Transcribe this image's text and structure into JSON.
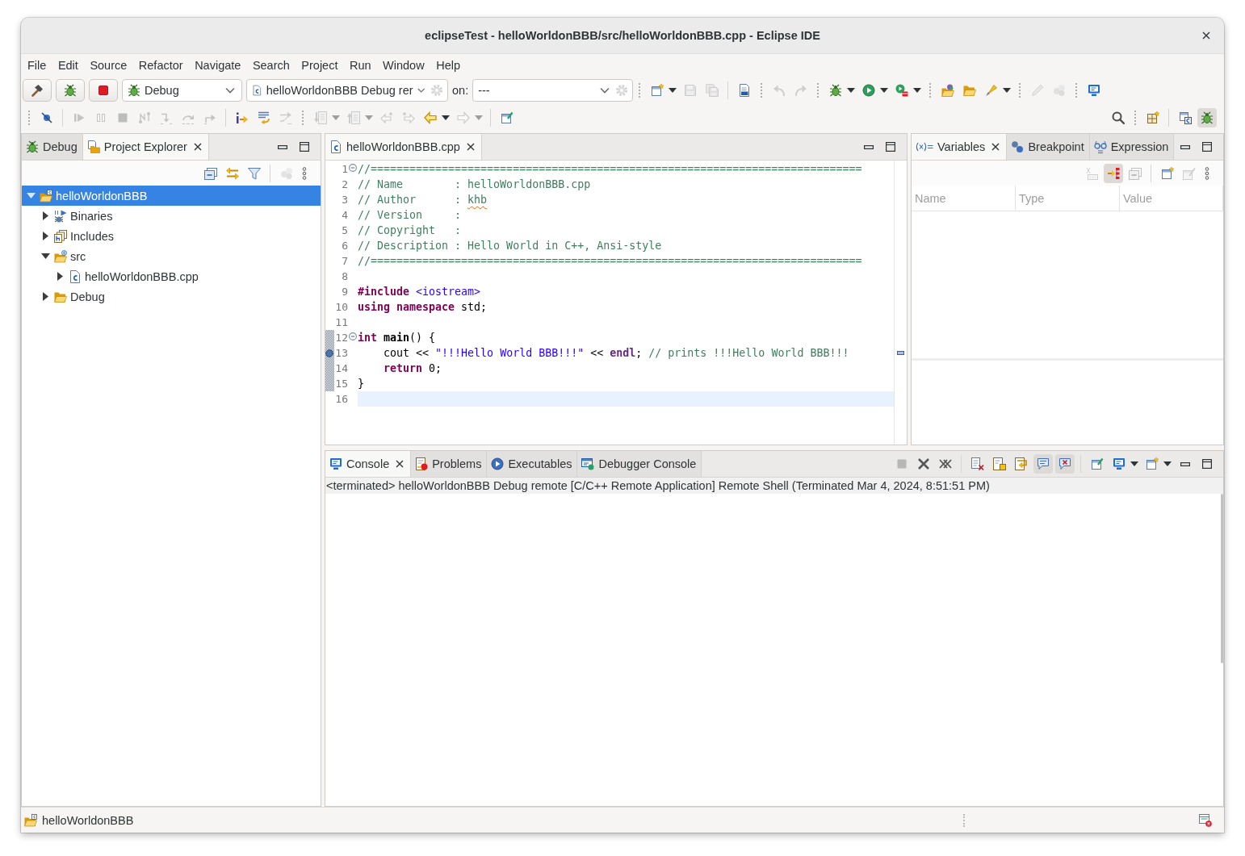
{
  "window": {
    "title": "eclipseTest - helloWorldonBBB/src/helloWorldonBBB.cpp - Eclipse IDE"
  },
  "menu": [
    "File",
    "Edit",
    "Source",
    "Refactor",
    "Navigate",
    "Search",
    "Project",
    "Run",
    "Window",
    "Help"
  ],
  "main_toolbar": {
    "launch_mode": "Debug",
    "launch_configuration": "helloWorldonBBB Debug rer",
    "target_label": "on:",
    "target": "---",
    "buttons": [
      {
        "disabled": false
      },
      {
        "disabled": false
      },
      {
        "disabled": false
      },
      {
        "disabled": true
      },
      {
        "disabled": true
      },
      {
        "disabled": false
      },
      {
        "disabled": false
      },
      {
        "disabled": true
      },
      {
        "disabled": true
      },
      {
        "disabled": false
      },
      {
        "disabled": true
      },
      {
        "disabled": true
      },
      {
        "disabled": false
      },
      {
        "disabled": false
      },
      {
        "disabled": false
      },
      {
        "disabled": false
      },
      {
        "disabled": false
      },
      {
        "disabled": false
      },
      {
        "disabled": false
      },
      {
        "disabled": false
      },
      {
        "disabled": false
      },
      {
        "disabled": false
      },
      {
        "disabled": true
      },
      {
        "disabled": true
      },
      {
        "disabled": false
      }
    ]
  },
  "debug_toolbar": {
    "buttons": [
      {
        "disabled": false,
        "on": false
      },
      {
        "disabled": true,
        "on": false
      },
      {
        "disabled": true,
        "on": false
      },
      {
        "disabled": true,
        "on": false
      },
      {
        "disabled": true,
        "on": false
      },
      {
        "disabled": true,
        "on": false
      },
      {
        "disabled": true,
        "on": false
      },
      {
        "disabled": true,
        "on": false
      },
      {
        "disabled": false,
        "on": false
      },
      {
        "disabled": false,
        "on": false
      },
      {
        "disabled": true,
        "on": false
      },
      {
        "disabled": true,
        "on": false
      },
      {
        "disabled": true,
        "on": false
      },
      {
        "disabled": true,
        "on": false
      },
      {
        "disabled": true,
        "on": false
      },
      {
        "disabled": true,
        "on": false
      },
      {
        "disabled": true,
        "on": false
      },
      {
        "disabled": false,
        "on": false
      },
      {
        "disabled": false,
        "on": false
      },
      {
        "disabled": true,
        "on": false
      },
      {
        "disabled": true,
        "on": false
      },
      {
        "disabled": false,
        "on": false
      },
      {
        "disabled": false,
        "on": false
      },
      {
        "disabled": false,
        "on": false
      },
      {
        "disabled": false,
        "on": false
      },
      {
        "disabled": false,
        "on": true
      }
    ]
  },
  "project_explorer": {
    "tabs": [
      {
        "label": "Debug",
        "selected": false
      },
      {
        "label": "Project Explorer",
        "selected": true
      }
    ],
    "toolbar": [
      {
        "disabled": false
      },
      {
        "disabled": false
      },
      {
        "disabled": false
      },
      {
        "disabled": true
      },
      {
        "disabled": false
      }
    ],
    "tree": [
      {
        "label": "helloWorldonBBB",
        "kind": "project",
        "expanded": true,
        "selected": true,
        "children": [
          {
            "label": "Binaries",
            "kind": "binaries",
            "expanded": false,
            "selected": false
          },
          {
            "label": "Includes",
            "kind": "includes",
            "expanded": false,
            "selected": false
          },
          {
            "label": "src",
            "kind": "source_folder",
            "expanded": true,
            "selected": false,
            "children": [
              {
                "label": "helloWorldonBBB.cpp",
                "kind": "source_file",
                "expanded": false,
                "selected": false
              }
            ]
          },
          {
            "label": "Debug",
            "kind": "folder",
            "expanded": false,
            "selected": false
          }
        ]
      }
    ]
  },
  "editor": {
    "tabs": [
      {
        "label": "helloWorldonBBB.cpp",
        "selected": true
      }
    ],
    "lines": [
      {
        "number": "1",
        "fold_marker": true,
        "breakpoint": false,
        "range_indicator": false,
        "current": false,
        "tokens": [
          {
            "text": "//============================================================================",
            "kind": "comment"
          }
        ]
      },
      {
        "number": "2",
        "fold_marker": false,
        "breakpoint": false,
        "range_indicator": false,
        "current": false,
        "tokens": [
          {
            "text": "// Name        : helloWorldonBBB.cpp",
            "kind": "comment"
          }
        ]
      },
      {
        "number": "3",
        "fold_marker": false,
        "breakpoint": false,
        "range_indicator": false,
        "current": false,
        "tokens": [
          {
            "text": "// Author      : ",
            "kind": "comment"
          },
          {
            "text": "khb",
            "kind": "misspelled"
          }
        ]
      },
      {
        "number": "4",
        "fold_marker": false,
        "breakpoint": false,
        "range_indicator": false,
        "current": false,
        "tokens": [
          {
            "text": "// Version     :",
            "kind": "comment"
          }
        ]
      },
      {
        "number": "5",
        "fold_marker": false,
        "breakpoint": false,
        "range_indicator": false,
        "current": false,
        "tokens": [
          {
            "text": "// Copyright   :",
            "kind": "comment"
          }
        ]
      },
      {
        "number": "6",
        "fold_marker": false,
        "breakpoint": false,
        "range_indicator": false,
        "current": false,
        "tokens": [
          {
            "text": "// Description : Hello World in C++, Ansi-style",
            "kind": "comment"
          }
        ]
      },
      {
        "number": "7",
        "fold_marker": false,
        "breakpoint": false,
        "range_indicator": false,
        "current": false,
        "tokens": [
          {
            "text": "//============================================================================",
            "kind": "comment"
          }
        ]
      },
      {
        "number": "8",
        "fold_marker": false,
        "breakpoint": false,
        "range_indicator": false,
        "current": false
      },
      {
        "number": "9",
        "fold_marker": false,
        "breakpoint": false,
        "range_indicator": false,
        "current": false,
        "tokens": [
          {
            "text": "#include",
            "kind": "directive"
          },
          {
            "text": " <iostream>",
            "kind": "header"
          }
        ]
      },
      {
        "number": "10",
        "fold_marker": false,
        "breakpoint": false,
        "range_indicator": false,
        "current": false,
        "tokens": [
          {
            "text": "using",
            "kind": "keyword"
          },
          {
            "text": " namespace",
            "kind": "keyword"
          },
          {
            "text": " std;",
            "kind": "plain"
          }
        ]
      },
      {
        "number": "11",
        "fold_marker": false,
        "breakpoint": false,
        "range_indicator": false,
        "current": false
      },
      {
        "number": "12",
        "fold_marker": true,
        "breakpoint": false,
        "range_indicator": true,
        "current": false,
        "tokens": [
          {
            "text": "int",
            "kind": "keyword"
          },
          {
            "text": " main",
            "kind": "function"
          },
          {
            "text": "() {",
            "kind": "plain"
          }
        ]
      },
      {
        "number": "13",
        "fold_marker": false,
        "breakpoint": true,
        "range_indicator": true,
        "current": false,
        "tokens": [
          {
            "text": "    cout << ",
            "kind": "plain"
          },
          {
            "text": "\"!!!Hello World BBB!!!\"",
            "kind": "string"
          },
          {
            "text": " << ",
            "kind": "plain"
          },
          {
            "text": "endl",
            "kind": "global"
          },
          {
            "text": "; ",
            "kind": "plain"
          },
          {
            "text": "// prints !!!Hello World BBB!!!",
            "kind": "comment"
          }
        ]
      },
      {
        "number": "14",
        "fold_marker": false,
        "breakpoint": false,
        "range_indicator": true,
        "current": false,
        "tokens": [
          {
            "text": "    return",
            "kind": "keyword"
          },
          {
            "text": " 0;",
            "kind": "plain"
          }
        ]
      },
      {
        "number": "15",
        "fold_marker": false,
        "breakpoint": false,
        "range_indicator": true,
        "current": false,
        "tokens": [
          {
            "text": "}",
            "kind": "plain"
          }
        ]
      },
      {
        "number": "16",
        "fold_marker": false,
        "breakpoint": false,
        "range_indicator": false,
        "current": true
      }
    ]
  },
  "variables_view": {
    "tabs": [
      {
        "label": "Variables",
        "selected": true
      },
      {
        "label": "Breakpoint",
        "selected": false
      },
      {
        "label": "Expression",
        "selected": false
      }
    ],
    "toolbar": [
      {
        "disabled": true,
        "on": false
      },
      {
        "disabled": false,
        "on": true
      },
      {
        "disabled": true,
        "on": false
      },
      {
        "disabled": false,
        "on": false
      },
      {
        "disabled": true,
        "on": false
      },
      {
        "disabled": false,
        "on": false
      }
    ],
    "columns": [
      "Name",
      "Type",
      "Value"
    ]
  },
  "console": {
    "tabs": [
      {
        "label": "Console",
        "selected": true
      },
      {
        "label": "Problems",
        "selected": false
      },
      {
        "label": "Executables",
        "selected": false
      },
      {
        "label": "Debugger Console",
        "selected": false
      }
    ],
    "toolbar": [
      {
        "disabled": true,
        "on": false
      },
      {
        "disabled": false,
        "on": false
      },
      {
        "disabled": false,
        "on": false
      },
      {
        "disabled": false,
        "on": false
      },
      {
        "disabled": false,
        "on": false
      },
      {
        "disabled": false,
        "on": false
      },
      {
        "disabled": false,
        "on": true
      },
      {
        "disabled": false,
        "on": true
      },
      {
        "disabled": false,
        "on": false
      },
      {
        "disabled": false,
        "on": false
      },
      {
        "disabled": false,
        "on": false
      },
      {
        "disabled": false,
        "on": false
      },
      {
        "disabled": false,
        "on": false
      }
    ],
    "description": "<terminated> helloWorldonBBB Debug remote [C/C++ Remote Application] Remote Shell (Terminated Mar 4, 2024, 8:51:51 PM)"
  },
  "status_bar": {
    "text": "helloWorldonBBB"
  }
}
